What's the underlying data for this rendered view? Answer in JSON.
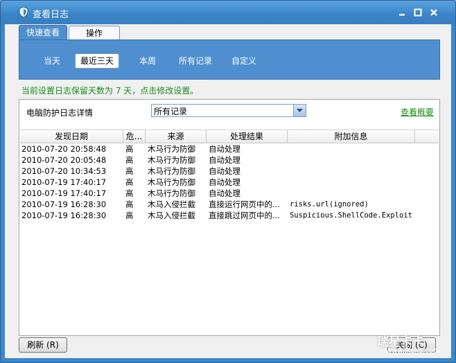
{
  "window": {
    "title": "查看日志"
  },
  "tabs": [
    {
      "label": "快速查看"
    },
    {
      "label": "操作"
    }
  ],
  "range_tabs": [
    {
      "label": "当天"
    },
    {
      "label": "最近三天"
    },
    {
      "label": "本周"
    },
    {
      "label": "所有记录"
    },
    {
      "label": "自定义"
    }
  ],
  "notice": "当前设置日志保留天数为 7 天，点击修改设置。",
  "filter": {
    "label": "电脑防护日志详情",
    "value": "所有记录"
  },
  "overview_link": "查看概要",
  "table": {
    "columns": [
      "发现日期",
      "危...",
      "来源",
      "处理结果",
      "附加信息"
    ],
    "rows": [
      [
        "2010-07-20 20:58:48",
        "高",
        "木马行为防御",
        "自动处理",
        ""
      ],
      [
        "2010-07-20 20:05:48",
        "高",
        "木马行为防御",
        "自动处理",
        ""
      ],
      [
        "2010-07-20 10:34:53",
        "高",
        "木马行为防御",
        "自动处理",
        ""
      ],
      [
        "2010-07-19 17:40:17",
        "高",
        "木马行为防御",
        "自动处理",
        ""
      ],
      [
        "2010-07-19 17:40:17",
        "高",
        "木马行为防御",
        "自动处理",
        ""
      ],
      [
        "2010-07-19 16:28:30",
        "高",
        "木马入侵拦截",
        "直接运行网页中的...",
        "risks.url(ignored)"
      ],
      [
        "2010-07-19 16:28:30",
        "高",
        "木马入侵拦截",
        "直接跳过网页中的...",
        "Suspicious.ShellCode.Exploit"
      ]
    ]
  },
  "buttons": {
    "refresh": "刷新 (R)",
    "close": "关闭 (C)"
  },
  "watermark": {
    "brand": "瑞星卡卡",
    "url": "www.ikaka.com"
  },
  "colors": {
    "title_bar": "#3a84c7",
    "tab_panel": "#4f8fcf",
    "notice_green": "#1a8d1a"
  }
}
